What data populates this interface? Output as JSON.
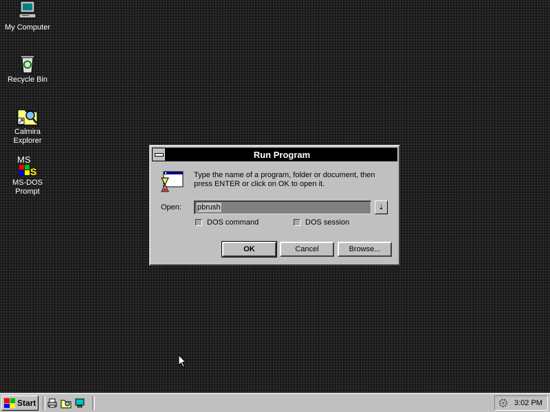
{
  "desktop": {
    "icons": [
      {
        "label": "My Computer",
        "icon": "computer-icon"
      },
      {
        "label": "Recycle Bin",
        "icon": "recycle-bin-icon"
      },
      {
        "label": "Calmira\nExplorer",
        "icon": "explorer-icon"
      },
      {
        "label": "MS-DOS\nPrompt",
        "icon": "ms-dos-icon",
        "glyph": "MS"
      }
    ]
  },
  "dialog": {
    "title": "Run Program",
    "description": "Type the name of a program, folder or document, then press ENTER or click on OK to open it.",
    "open_label": "Open:",
    "open_value": "pbrush",
    "combo_arrow": "⇣",
    "dos_command_label": "DOS command",
    "dos_session_label": "DOS session",
    "ok_label": "OK",
    "cancel_label": "Cancel",
    "browse_label": "Browse..."
  },
  "taskbar": {
    "start_label": "Start",
    "clock": "3:02 PM"
  },
  "colors": {
    "desktop_bg": "#1a1a1a",
    "face": "#c0c0c0",
    "titlebar": "#000000"
  }
}
